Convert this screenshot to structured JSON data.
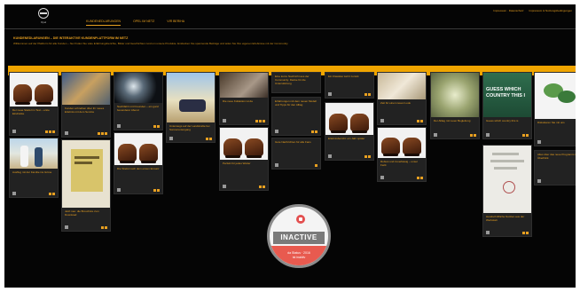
{
  "header": {
    "brand": "Opel",
    "nav": [
      {
        "label": "KUNDENEDLARUNGEN",
        "active": true
      },
      {
        "label": "OPEL IM NETZ",
        "active": false
      },
      {
        "label": "VIR BERIHA",
        "active": false
      }
    ],
    "top_links": [
      "Impressum · Datenschutz",
      "Impressum & Nutzungsbedingungen"
    ]
  },
  "intro": {
    "title": "KUNDENEDLARUNGEN – DIE INTERAKTIVE KUNDENPLATTFORM IM NETZ",
    "text": "Willkommen auf der Plattform für alle Kunden – hier finden Sie viele Erfahrungsberichte, Bilder und Geschichten rund um unsere Produkte. Entdecken Sie spannende Beiträge und teilen Sie Ihre eigenen Erlebnisse mit der Community."
  },
  "colors": {
    "accent": "#f0a500",
    "card": "#222222",
    "badge_red": "#e85a4f",
    "badge_gray": "#7a7a7a"
  },
  "cards": [
    {
      "caption": "Der neue Stiefel im Test – erste Eindrücke"
    },
    {
      "caption": "Kunden schreiben über ihr neues Erlebnis mit dem Service"
    },
    {
      "caption": "Nachtfahrt mit Freunden – ein ganz besonderer Abend"
    },
    {
      "caption": "Unterwegs auf der Landstraße bei Sonnenuntergang"
    },
    {
      "caption": "Die neue Kollektion ist da"
    },
    {
      "caption": "Eine kurze Nachricht aus der Community: Danke für die Unterstützung"
    },
    {
      "caption": "Erfahrungen mit dem neuen Modell und Tipps für den Alltag"
    },
    {
      "caption": "Ein Klassiker kehrt zurück"
    },
    {
      "caption": "Zeit für einen neuen Look"
    },
    {
      "caption": "Der Alltag mit neuer Begleitung"
    },
    {
      "caption": "Guess which country this is"
    },
    {
      "caption": "Diskutieren Sie mit uns"
    },
    {
      "caption": "Ausflug mit der Familie ins Grüne"
    },
    {
      "caption": "Jetzt neu: die Broschüre zum Download"
    },
    {
      "caption": "Die Stiefel nach dem ersten Einsatz"
    },
    {
      "caption": "Perfekt für jedes Wetter"
    },
    {
      "caption": "Gute Nachrichten für alle Fans"
    },
    {
      "caption": "Erlebnisbericht: ein Jahr später"
    },
    {
      "caption": "Robust und zuverlässig – unser Fazit"
    },
    {
      "caption": "Handschriftliche Notizen aus der Werkstatt"
    },
    {
      "caption": "Alles über das neue Programm im Überblick"
    }
  ],
  "image_texts": {
    "country_tile": "GUESS WHICH COUNTRY THIS I"
  },
  "badge": {
    "label": "INACTIVE",
    "line1": "da Status · 2016",
    "line2": "ist inaktiv"
  }
}
